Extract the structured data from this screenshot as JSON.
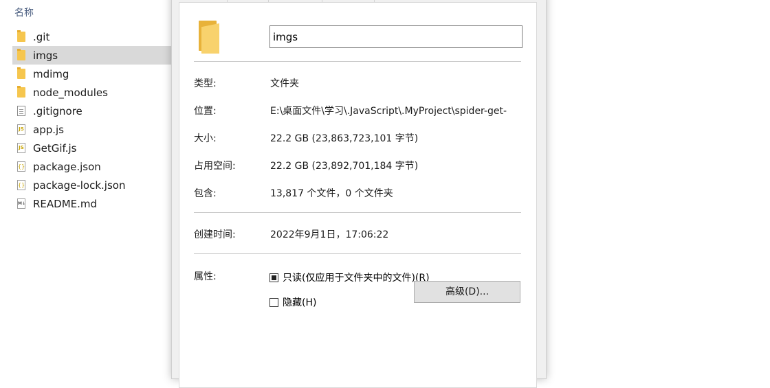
{
  "explorer": {
    "column_header": "名称",
    "sort_icon": "chevron-up",
    "files": [
      {
        "name": ".git",
        "type": "folder"
      },
      {
        "name": "imgs",
        "type": "folder",
        "selected": true
      },
      {
        "name": "mdimg",
        "type": "folder"
      },
      {
        "name": "node_modules",
        "type": "folder"
      },
      {
        "name": ".gitignore",
        "type": "doc"
      },
      {
        "name": "app.js",
        "type": "js"
      },
      {
        "name": "GetGif.js",
        "type": "js"
      },
      {
        "name": "package.json",
        "type": "json"
      },
      {
        "name": "package-lock.json",
        "type": "json"
      },
      {
        "name": "README.md",
        "type": "md"
      }
    ]
  },
  "properties": {
    "folder_name": "imgs",
    "type_label": "类型:",
    "type_value": "文件夹",
    "location_label": "位置:",
    "location_value": "E:\\桌面文件\\学习\\.JavaScript\\.MyProject\\spider-get-",
    "size_label": "大小:",
    "size_value": "22.2 GB (23,863,723,101 字节)",
    "size_on_disk_label": "占用空间:",
    "size_on_disk_value": "22.2 GB (23,892,701,184 字节)",
    "contains_label": "包含:",
    "contains_value": "13,817 个文件，0 个文件夹",
    "created_label": "创建时间:",
    "created_value": "2022年9月1日，17:06:22",
    "attributes_label": "属性:",
    "readonly_label": "只读(仅应用于文件夹中的文件)(R)",
    "readonly_state": "indeterminate",
    "hidden_label": "隐藏(H)",
    "hidden_state": "unchecked",
    "advanced_button": "高级(D)..."
  }
}
